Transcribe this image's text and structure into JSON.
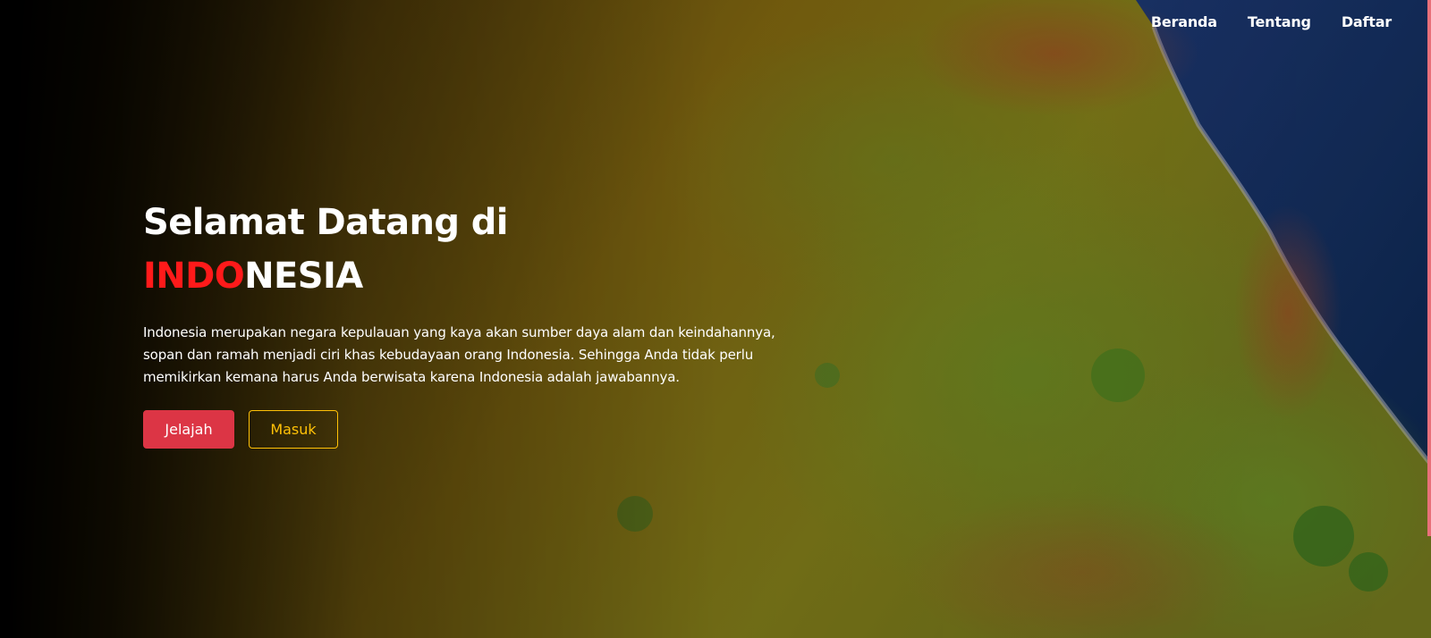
{
  "nav": {
    "items": [
      {
        "label": "Beranda"
      },
      {
        "label": "Tentang"
      },
      {
        "label": "Daftar"
      }
    ]
  },
  "hero": {
    "title_line1": "Selamat Datang di",
    "title_highlight": "INDO",
    "title_rest": "NESIA",
    "description_lines": [
      "Indonesia merupakan negara kepulauan yang kaya akan sumber daya alam dan keindahannya,",
      "sopan dan ramah menjadi ciri khas kebudayaan orang Indonesia. Sehingga Anda tidak perlu",
      "memikirkan kemana harus Anda berwisata karena Indonesia adalah jawabannya."
    ],
    "primary_button": "Jelajah",
    "secondary_button": "Masuk"
  },
  "colors": {
    "accent_red": "#dc3545",
    "highlight_red": "#ff1a1a",
    "outline_yellow": "#ffc107",
    "sea_blue": "#123a6e",
    "grass_green": "#7f9a2a",
    "earth_brown": "#8a6a10"
  }
}
